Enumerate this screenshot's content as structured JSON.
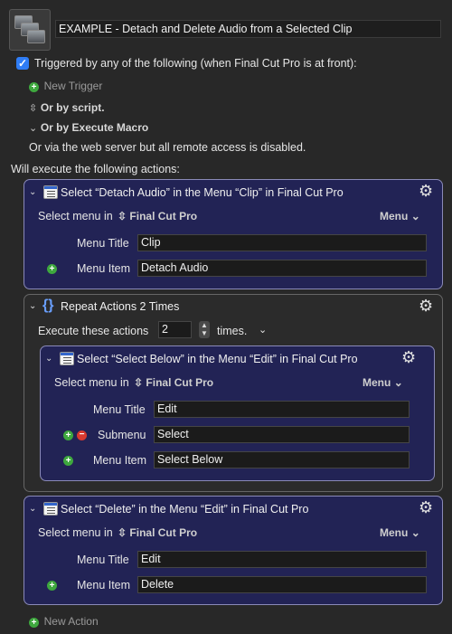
{
  "macro": {
    "title": "EXAMPLE - Detach and Delete Audio from a Selected Clip"
  },
  "triggers": {
    "triggered_label": "Triggered by any of the following (when Final Cut Pro is at front):",
    "new_trigger": "New Trigger",
    "by_script": "Or by script.",
    "by_execute_macro": "Or by Execute Macro",
    "web_server": "Or via the web server but all remote access is disabled.",
    "checkbox_mark": "✓"
  },
  "will_execute": "Will execute the following actions:",
  "actions": {
    "a1": {
      "title": "Select “Detach Audio” in the Menu “Clip” in Final Cut Pro",
      "select_menu_in": "Select menu in",
      "app": "Final Cut Pro",
      "menu_label": "Menu",
      "menu_title_label": "Menu Title",
      "menu_title_value": "Clip",
      "menu_item_label": "Menu Item",
      "menu_item_value": "Detach Audio"
    },
    "repeat": {
      "title": "Repeat Actions 2 Times",
      "execute_label": "Execute these actions",
      "count": "2",
      "times": "times."
    },
    "a2": {
      "title": "Select “Select Below” in the Menu “Edit” in Final Cut Pro",
      "select_menu_in": "Select menu in",
      "app": "Final Cut Pro",
      "menu_label": "Menu",
      "menu_title_label": "Menu Title",
      "menu_title_value": "Edit",
      "submenu_label": "Submenu",
      "submenu_value": "Select",
      "menu_item_label": "Menu Item",
      "menu_item_value": "Select Below"
    },
    "a3": {
      "title": "Select “Delete” in the Menu “Edit” in Final Cut Pro",
      "select_menu_in": "Select menu in",
      "app": "Final Cut Pro",
      "menu_label": "Menu",
      "menu_title_label": "Menu Title",
      "menu_title_value": "Edit",
      "menu_item_label": "Menu Item",
      "menu_item_value": "Delete"
    }
  },
  "new_action": "New Action",
  "glyphs": {
    "plus": "+",
    "minus": "−",
    "chevron_down": "⌄",
    "updown": "⇳",
    "gear": "⚙",
    "brace": "{}"
  },
  "colors": {
    "action_bg": "#222355",
    "checkbox_blue": "#2f7df6",
    "add_green": "#3ea83e",
    "remove_red": "#d9392f"
  }
}
